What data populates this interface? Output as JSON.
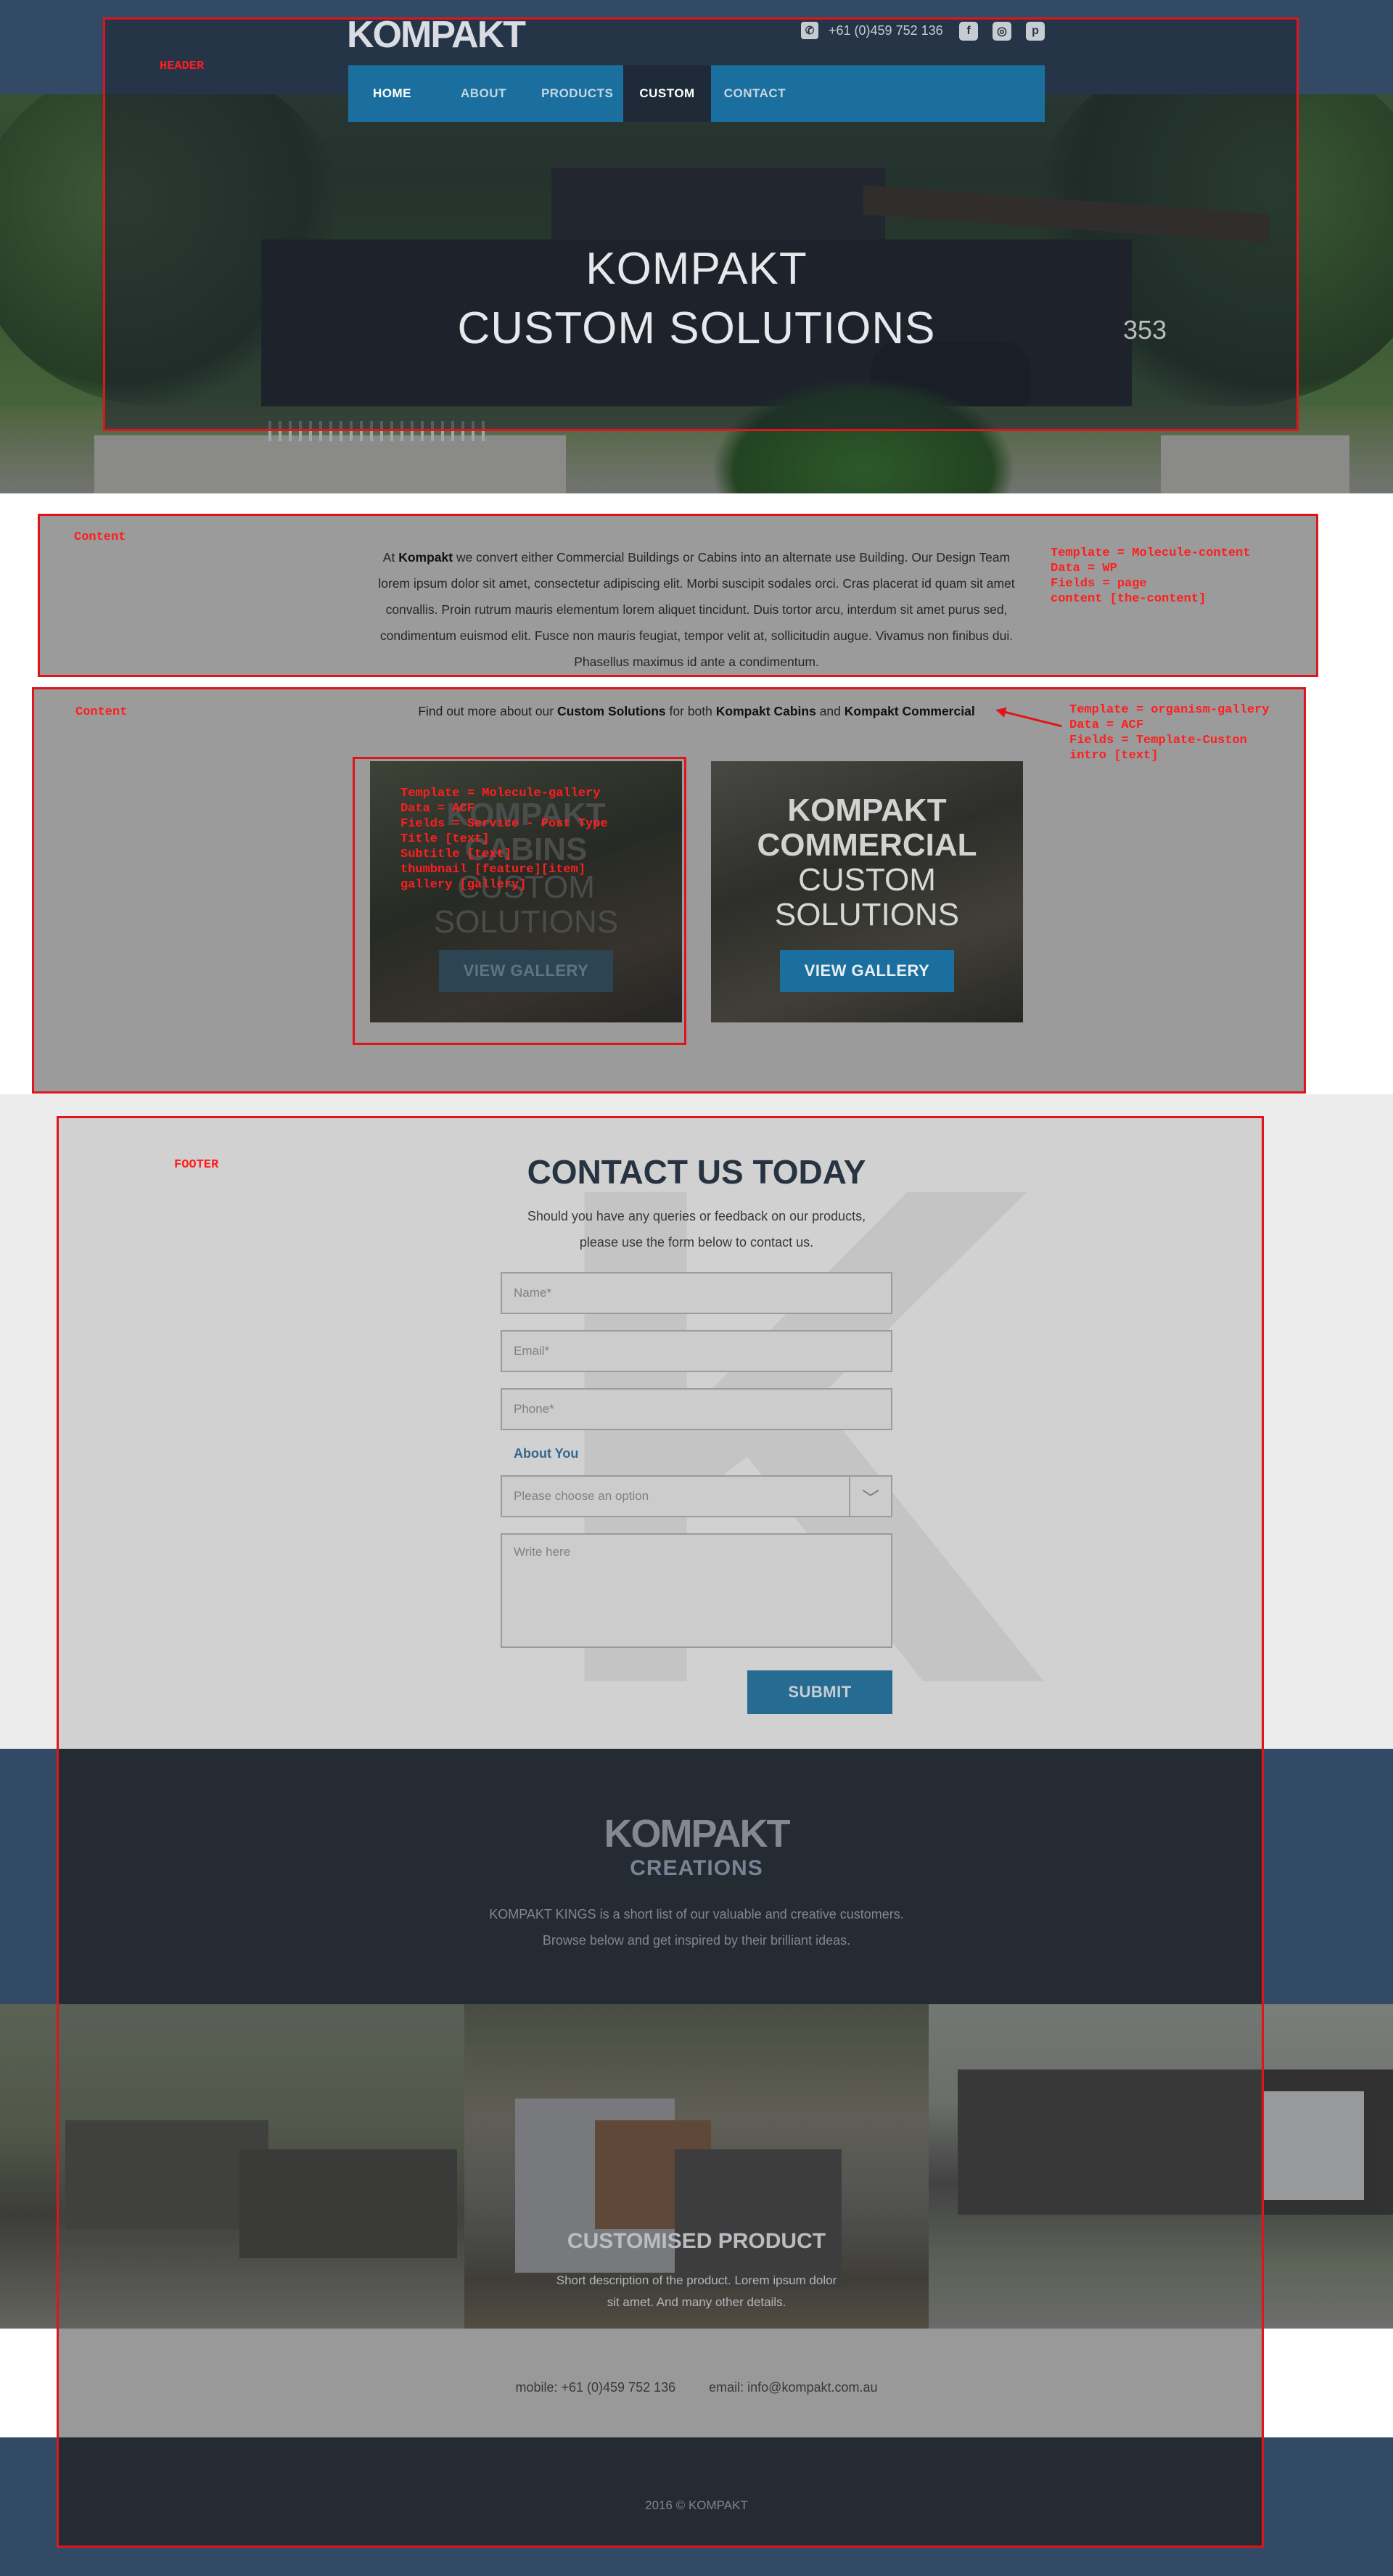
{
  "annotations": {
    "header": "HEADER",
    "content1": "Content",
    "content1_note": [
      "Template = Molecule-content",
      "Data  = WP",
      "Fields = page",
      "content [the-content]"
    ],
    "content2": "Content",
    "content2_note": [
      "Template = organism-gallery",
      "Data  = ACF",
      "Fields = Template-Custon",
      "intro [text]"
    ],
    "card_note": [
      "Template = Molecule-gallery",
      "Data  = ACF",
      "Fields = Service - Post Type",
      "Title [text]",
      "Subtitle [text]",
      "thumbnail [feature][item]",
      "gallery [gallery]"
    ],
    "footer": "FOOTER"
  },
  "header": {
    "logo": "KOMPAKT",
    "phone": "+61 (0)459 752 136",
    "nav": [
      "HOME",
      "ABOUT",
      "PRODUCTS",
      "CUSTOM",
      "CONTACT"
    ],
    "active_nav": "CUSTOM",
    "hero_title_line1": "KOMPAKT",
    "hero_title_line2": "CUSTOM SOLUTIONS",
    "house_number": "353"
  },
  "icons": {
    "phone": "phone-icon",
    "facebook": "facebook-icon",
    "instagram": "instagram-icon",
    "pinterest": "pinterest-icon",
    "chevron": "chevron-down-icon"
  },
  "intro": {
    "pre": "At ",
    "brand": "Kompakt",
    "rest": " we convert either Commercial Buildings or Cabins into an alternate use Building. Our Design Team lorem ipsum dolor sit amet, consectetur adipiscing elit. Morbi suscipit sodales orci. Cras placerat id quam sit amet convallis. Proin rutrum mauris elementum lorem aliquet tincidunt. Duis tortor arcu, interdum sit amet purus sed, condimentum euismod elit. Fusce non mauris feugiat, tempor velit at, sollicitudin augue. Vivamus non finibus dui. Phasellus maximus id ante a condimentum."
  },
  "gallery": {
    "find_pre": "Find out more about our ",
    "find_custom": "Custom Solutions",
    "find_mid": " for both ",
    "find_cabins": "Kompakt Cabins",
    "find_and": " and ",
    "find_commercial": "Kompakt Commercial",
    "cards": [
      {
        "title_line1": "KOMPAKT",
        "title_line2": "CABINS",
        "subtitle_line1": "CUSTOM",
        "subtitle_line2": "SOLUTIONS",
        "button": "VIEW GALLERY"
      },
      {
        "title_line1": "KOMPAKT",
        "title_line2": "COMMERCIAL",
        "subtitle_line1": "CUSTOM",
        "subtitle_line2": "SOLUTIONS",
        "button": "VIEW GALLERY"
      }
    ]
  },
  "contact": {
    "title": "CONTACT US TODAY",
    "subtitle_line1": "Should you have any queries or feedback on our products,",
    "subtitle_line2": "please use the form below to contact us.",
    "name_placeholder": "Name*",
    "email_placeholder": "Email*",
    "phone_placeholder": "Phone*",
    "about_label": "About You",
    "select_placeholder": "Please choose an option",
    "message_placeholder": "Write here",
    "submit": "SUBMIT"
  },
  "creations": {
    "logo": "KOMPAKT",
    "subtitle": "CREATIONS",
    "text_line1": "KOMPAKT KINGS is a short list of our valuable and creative customers.",
    "text_line2": "Browse below and get inspired by their brilliant ideas.",
    "product_title": "CUSTOMISED PRODUCT",
    "product_desc_line1": "Short description of the product. Lorem ipsum dolor",
    "product_desc_line2": "sit amet. And many other details."
  },
  "footer": {
    "mobile": "mobile: +61 (0)459 752 136",
    "email": "email: info@kompakt.com.au",
    "copyright": "2016 © KOMPAKT"
  },
  "colors": {
    "brand_blue": "#1b6f9e",
    "navy": "#334a66",
    "dark": "#1a212b",
    "annotation_red": "#e0141b"
  }
}
